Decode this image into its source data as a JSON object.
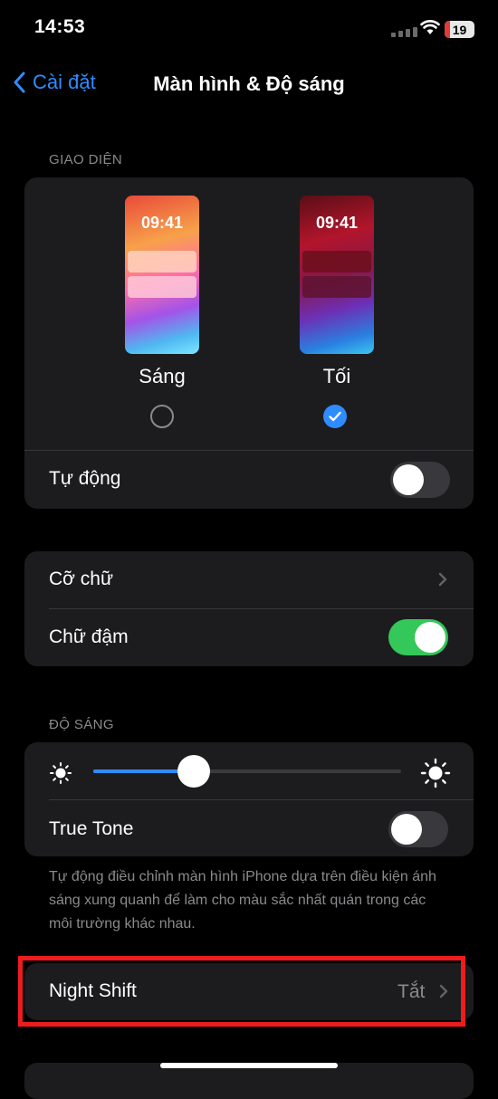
{
  "status_bar": {
    "time": "14:53",
    "battery": "19"
  },
  "nav": {
    "back_label": "Cài đặt",
    "title": "Màn hình & Độ sáng"
  },
  "appearance": {
    "header": "GIAO DIỆN",
    "preview_time": "09:41",
    "light_label": "Sáng",
    "dark_label": "Tối",
    "selected": "dark",
    "auto_label": "Tự động",
    "auto_on": false
  },
  "text": {
    "size_label": "Cỡ chữ",
    "bold_label": "Chữ đậm",
    "bold_on": true
  },
  "brightness": {
    "header": "ĐỘ SÁNG",
    "level": 0.33,
    "true_tone_label": "True Tone",
    "true_tone_on": false,
    "footnote": "Tự động điều chỉnh màn hình iPhone dựa trên điều kiện ánh sáng xung quanh để làm cho màu sắc nhất quán trong các môi trường khác nhau."
  },
  "night_shift": {
    "label": "Night Shift",
    "value": "Tắt"
  },
  "colors": {
    "accent": "#2f8cff",
    "toggle_on": "#34c759",
    "highlight": "#ee1c1c"
  }
}
